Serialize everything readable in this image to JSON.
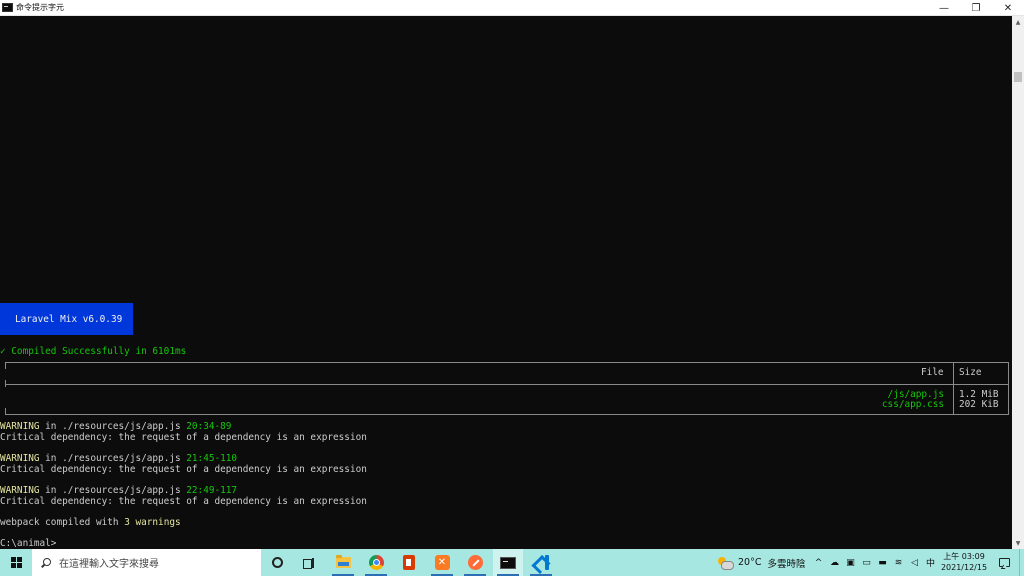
{
  "window": {
    "title": "命令提示字元",
    "controls": {
      "minimize": "—",
      "restore": "❐",
      "close": "✕"
    }
  },
  "console": {
    "mix_banner": "Laravel Mix v6.0.39",
    "compiled": "✓ Compiled Successfully in 6101ms",
    "table": {
      "headers": {
        "file": "File",
        "size": "Size"
      },
      "rows": [
        {
          "file": "/js/app.js",
          "size": "1.2 MiB"
        },
        {
          "file": "css/app.css",
          "size": "202 KiB"
        }
      ]
    },
    "warnings": [
      {
        "prefix": "WARNING",
        "path": " in ./resources/js/app.js ",
        "location": "20:34-89",
        "detail": "Critical dependency: the request of a dependency is an expression"
      },
      {
        "prefix": "WARNING",
        "path": " in ./resources/js/app.js ",
        "location": "21:45-110",
        "detail": "Critical dependency: the request of a dependency is an expression"
      },
      {
        "prefix": "WARNING",
        "path": " in ./resources/js/app.js ",
        "location": "22:49-117",
        "detail": "Critical dependency: the request of a dependency is an expression"
      }
    ],
    "summary": {
      "before": "webpack compiled with ",
      "count": "3 warnings"
    },
    "prompt": "C:\\animal>"
  },
  "scrollbar": {
    "up": "▲",
    "down": "▼"
  },
  "taskbar": {
    "search_placeholder": "在這裡輸入文字來搜尋",
    "apps": [
      {
        "name": "cortana-icon"
      },
      {
        "name": "task-view-icon"
      },
      {
        "name": "file-explorer-icon"
      },
      {
        "name": "chrome-icon"
      },
      {
        "name": "office-icon"
      },
      {
        "name": "xampp-icon"
      },
      {
        "name": "postman-icon"
      },
      {
        "name": "command-prompt-icon"
      },
      {
        "name": "vscode-icon"
      }
    ],
    "weather": {
      "temp": "20°C",
      "condition": "多雲時陰"
    },
    "tray": {
      "chevron": "^",
      "ime": "中"
    },
    "clock": {
      "time": "上午 03:09",
      "date": "2021/12/15"
    }
  },
  "colors": {
    "console_bg": "#0c0c0c",
    "console_text": "#cccccc",
    "success_green": "#16c60c",
    "warning_yellow": "#e5e5a0",
    "mix_blue": "#0037da",
    "taskbar_bg": "#a7e7e1"
  }
}
